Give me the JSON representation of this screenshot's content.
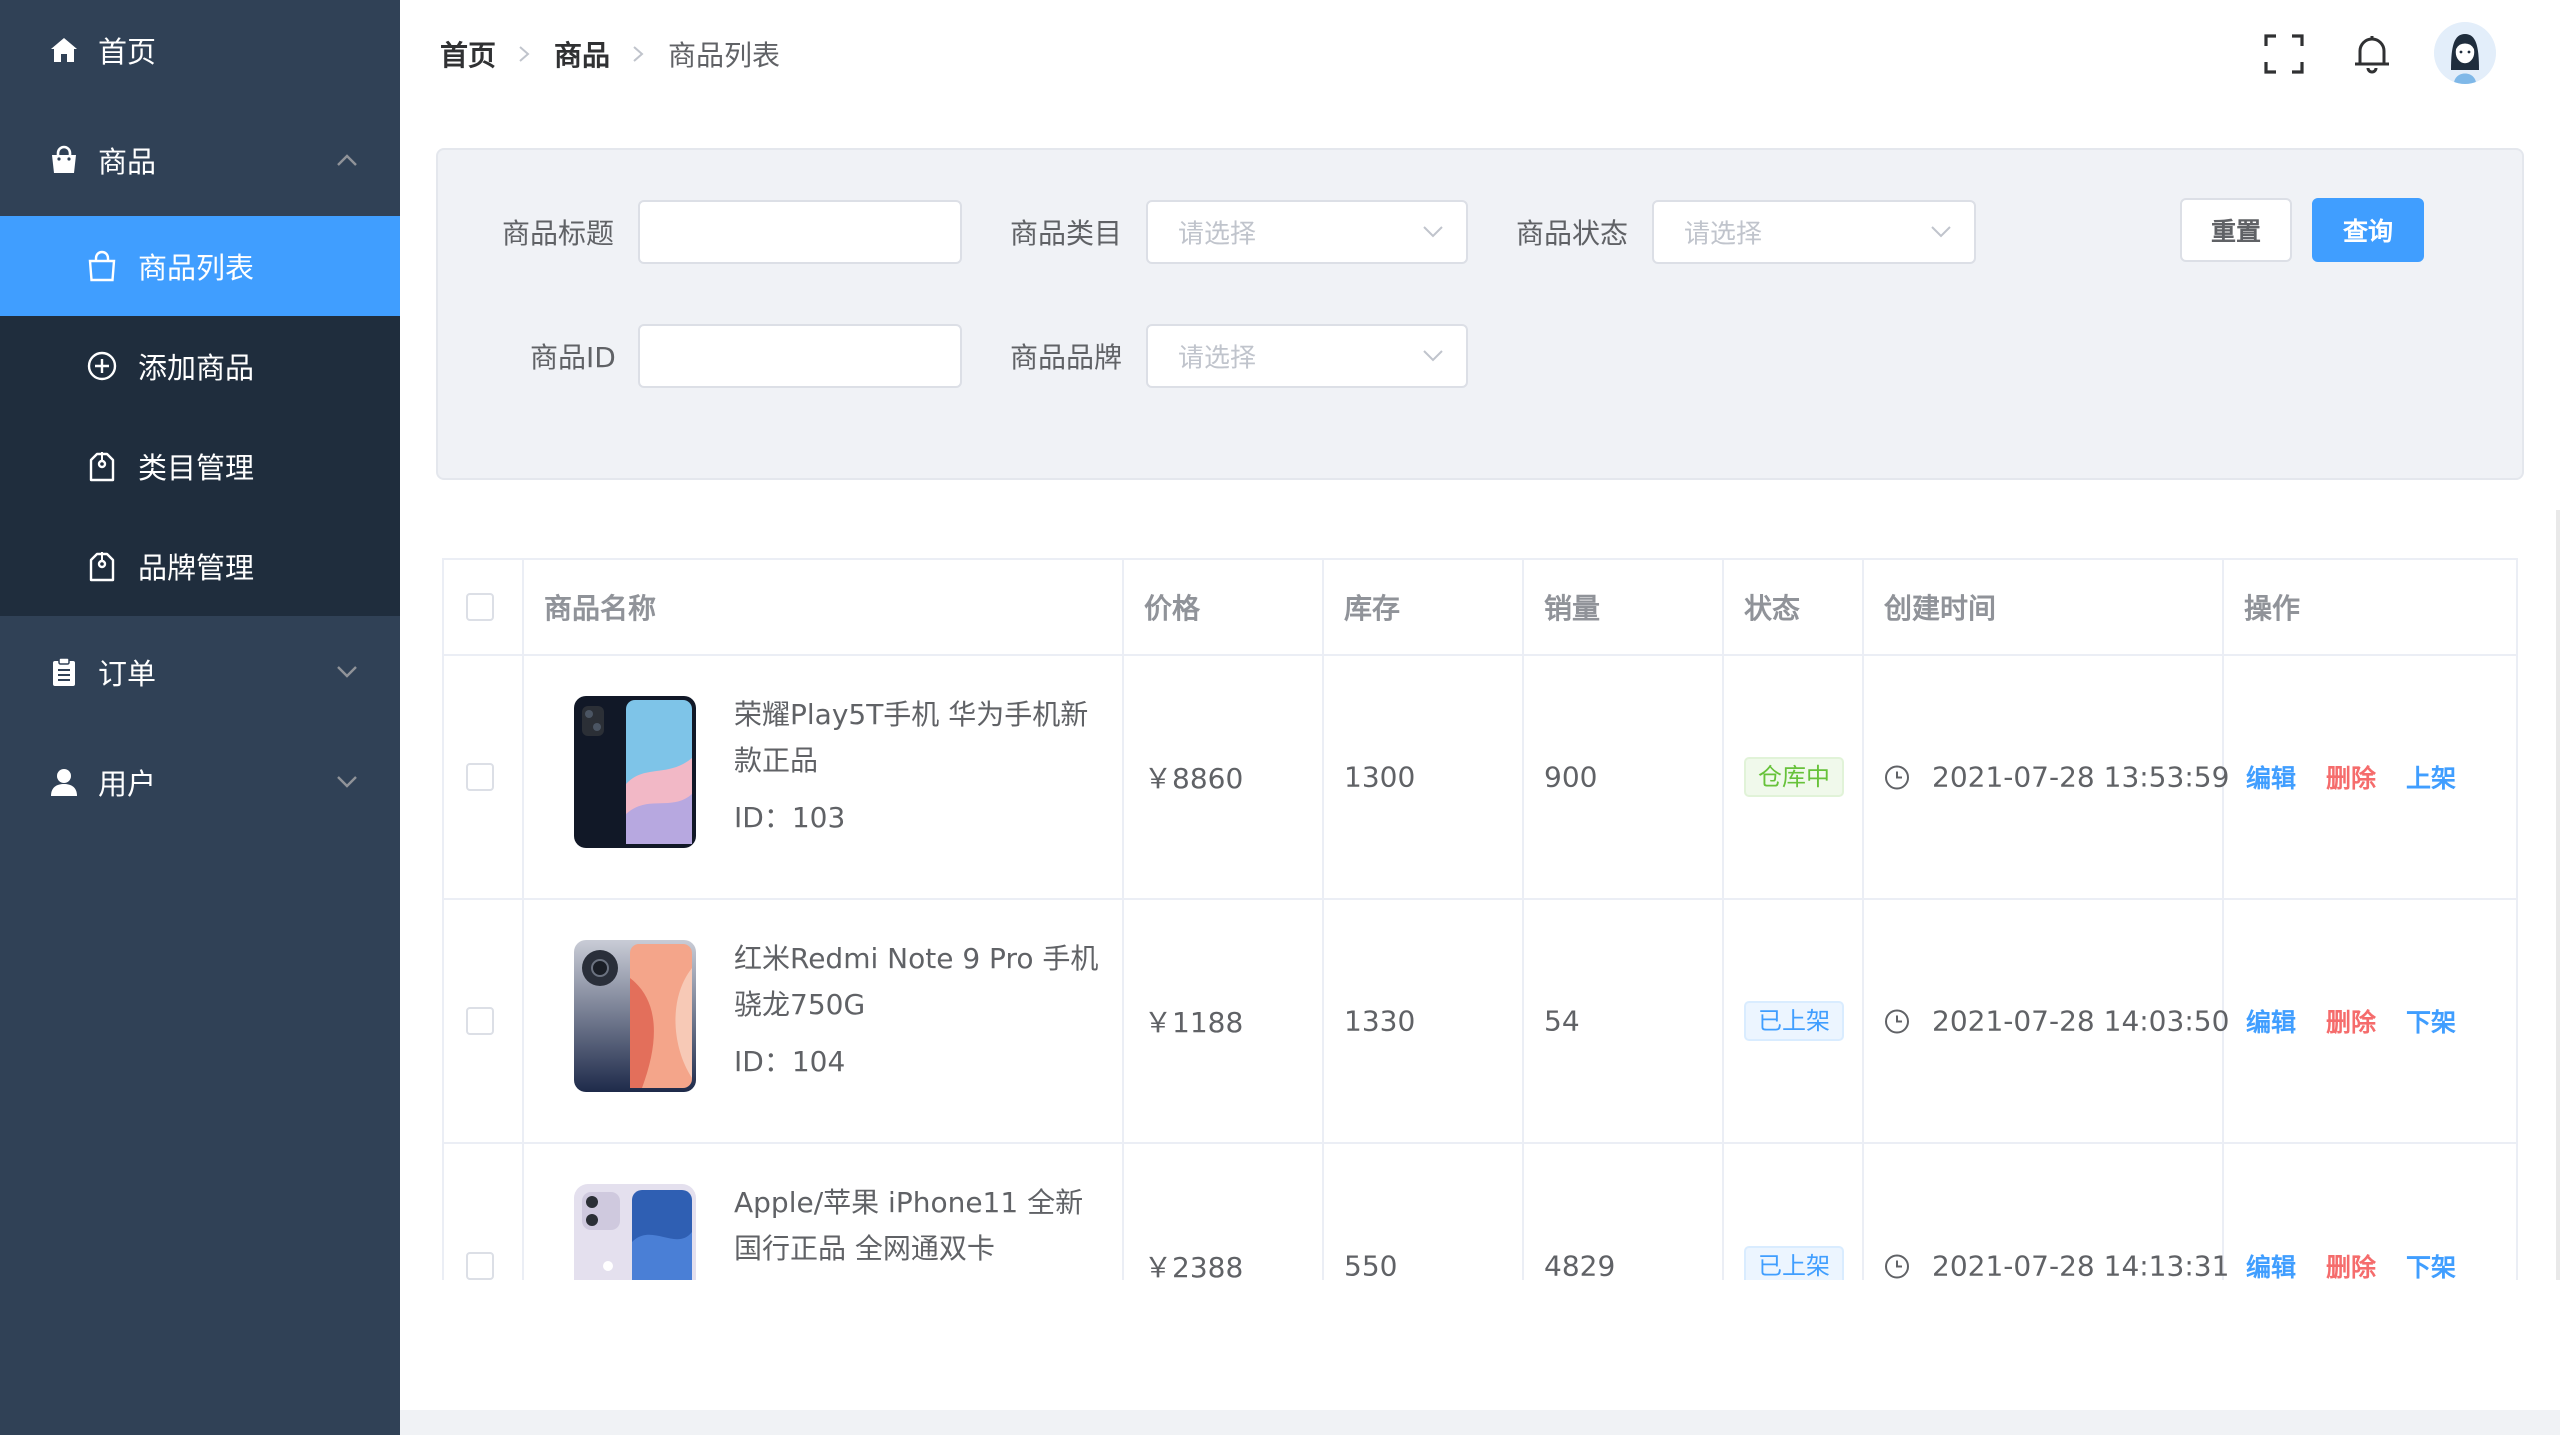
{
  "sidebar": {
    "home": {
      "label": "首页",
      "icon": "home-icon"
    },
    "goods": {
      "label": "商品",
      "icon": "shopping-bag-icon"
    },
    "sub_items": [
      {
        "label": "商品列表",
        "icon": "shopping-bag-outline-icon",
        "active": true
      },
      {
        "label": "添加商品",
        "icon": "plus-circle-icon",
        "active": false
      },
      {
        "label": "类目管理",
        "icon": "tag-icon",
        "active": false
      },
      {
        "label": "品牌管理",
        "icon": "tag-icon",
        "active": false
      }
    ],
    "orders": {
      "label": "订单",
      "icon": "clipboard-icon"
    },
    "users": {
      "label": "用户",
      "icon": "user-icon"
    }
  },
  "breadcrumb": [
    "首页",
    "商品",
    "商品列表"
  ],
  "header_icons": [
    "fullscreen-icon",
    "bell-icon",
    "avatar"
  ],
  "filters": {
    "title_label": "商品标题",
    "title_value": "",
    "category_label": "商品类目",
    "category_placeholder": "请选择",
    "status_label": "商品状态",
    "status_placeholder": "请选择",
    "id_label": "商品ID",
    "id_value": "",
    "brand_label": "商品品牌",
    "brand_placeholder": "请选择",
    "reset_label": "重置",
    "query_label": "查询"
  },
  "table": {
    "columns": [
      "商品名称",
      "价格",
      "库存",
      "销量",
      "状态",
      "创建时间",
      "操作"
    ],
    "rows": [
      {
        "name": "荣耀Play5T手机 华为手机新款正品",
        "id_text": "ID：103",
        "price": "￥8860",
        "stock": "1300",
        "sales": "900",
        "status": "仓库中",
        "status_type": "green",
        "created": "2021-07-28 13:53:59",
        "ops": [
          "编辑",
          "删除",
          "上架"
        ]
      },
      {
        "name": "红米Redmi Note 9 Pro 手机 骁龙750G",
        "id_text": "ID：104",
        "price": "￥1188",
        "stock": "1330",
        "sales": "54",
        "status": "已上架",
        "status_type": "blue",
        "created": "2021-07-28 14:03:50",
        "ops": [
          "编辑",
          "删除",
          "下架"
        ]
      },
      {
        "name": "Apple/苹果 iPhone11 全新国行正品 全网通双卡",
        "id_text": "",
        "price": "￥2388",
        "stock": "550",
        "sales": "4829",
        "status": "已上架",
        "status_type": "blue",
        "created": "2021-07-28 14:13:31",
        "ops": [
          "编辑",
          "删除",
          "下架"
        ]
      }
    ]
  },
  "colors": {
    "sidebar_bg": "#304156",
    "submenu_bg": "#1f2d3d",
    "primary": "#409eff",
    "danger": "#f56c6c",
    "success": "#67c23a"
  }
}
